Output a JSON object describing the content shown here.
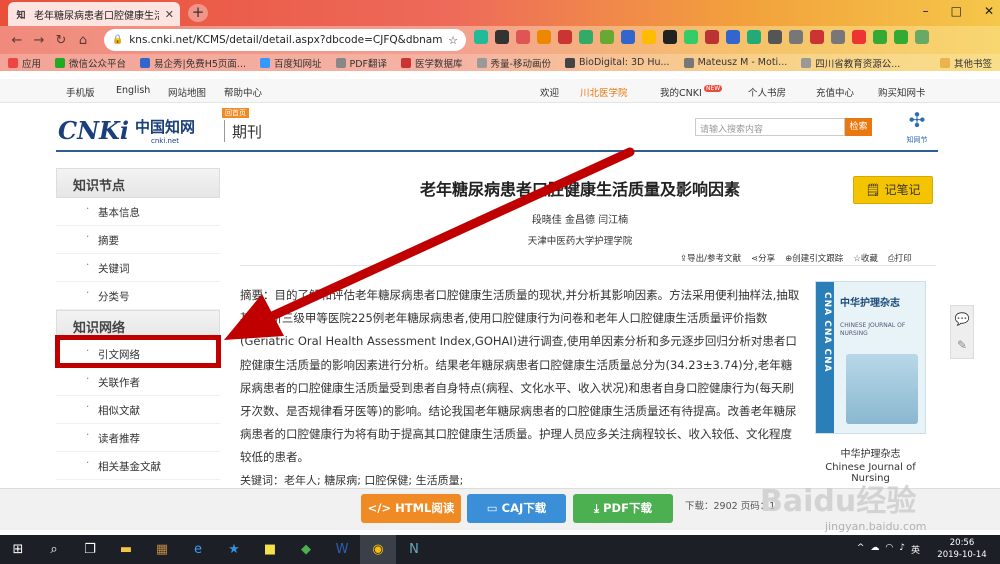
{
  "browser": {
    "tab_title": "老年糖尿病患者口腔健康生活质量",
    "tab_favicon": "知",
    "new_tab": "+",
    "url": "kns.cnki.net/KCMS/detail/detail.aspx?dbcode=CJFQ&dbnam...",
    "window_controls": [
      "–",
      "□",
      "✕"
    ],
    "bookmarks": [
      {
        "label": "应用",
        "color": "#e44"
      },
      {
        "label": "微信公众平台",
        "color": "#2a2"
      },
      {
        "label": "易企秀|免费H5页面...",
        "color": "#36c"
      },
      {
        "label": "百度知网址",
        "color": "#39f"
      },
      {
        "label": "PDF翻译",
        "color": "#888"
      },
      {
        "label": "医学数据库",
        "color": "#c33"
      },
      {
        "label": "秀量-移动画份",
        "color": "#999"
      },
      {
        "label": "BioDigital: 3D Hu...",
        "color": "#444"
      },
      {
        "label": "Mateusz M - Moti...",
        "color": "#777"
      },
      {
        "label": "四川省教育资源公...",
        "color": "#999"
      },
      {
        "label": "其他书签",
        "color": "#e9b44c"
      }
    ],
    "extension_colors": [
      "#2b9",
      "#333",
      "#d55",
      "#e80",
      "#c33",
      "#3a6",
      "#6a3",
      "#36c",
      "#fb0",
      "#222",
      "#3c6",
      "#b33",
      "#36c",
      "#2a7",
      "#555",
      "#777",
      "#c33",
      "#777",
      "#e33",
      "#3a3",
      "#3a3",
      "#6a6"
    ]
  },
  "cnki_nav": {
    "left": [
      "手机版",
      "English",
      "网站地图",
      "帮助中心"
    ],
    "right": [
      "欢迎",
      "川北医学院",
      "我的CNKI",
      "个人书房",
      "充值中心",
      "购买知网卡"
    ],
    "new_badge": "NEW"
  },
  "header": {
    "logo_en": "CNKi",
    "logo_cn": "中国知网",
    "logo_sub": "cnki.net",
    "home_badge": "回首页",
    "section": "期刊",
    "search_placeholder": "请输入搜索内容",
    "search_button": "检索",
    "brand": "知网节"
  },
  "sidebar": {
    "section1": "知识节点",
    "items1": [
      "基本信息",
      "摘要",
      "关键词",
      "分类号"
    ],
    "section2": "知识网络",
    "items2": [
      "引文网络",
      "关联作者",
      "相似文献",
      "读者推荐",
      "相关基金文献"
    ]
  },
  "article": {
    "title": "老年糖尿病患者口腔健康生活质量及影响因素",
    "authors": "段晓佳   金昌德   闫江楠",
    "affiliation": "天津中医药大学护理学院",
    "note_button": "记笔记",
    "tools": [
      "导出/参考文献",
      "分享",
      "创建引文跟踪",
      "收藏",
      "打印"
    ],
    "abstract": "摘要：目的了解和评估老年糖尿病患者口腔健康生活质量的现状,并分析其影响因素。方法采用便利抽样法,抽取某市2所三级甲等医院225例老年糖尿病患者,使用口腔健康行为问卷和老年人口腔健康生活质量评价指数(Geriatric Oral Health Assessment Index,GOHAI)进行调查,使用单因素分析和多元逐步回归分析对患者口腔健康生活质量的影响因素进行分析。结果老年糖尿病患者口腔健康生活质量总分为(34.23±3.74)分,老年糖尿病患者的口腔健康生活质量受到患者自身特点(病程、文化水平、收入状况)和患者自身口腔健康行为(每天刷牙次数、是否规律看牙医等)的影响。结论我国老年糖尿病患者的口腔健康生活质量还有待提高。改善老年糖尿病患者的口腔健康行为将有助于提高其口腔健康生活质量。护理人员应多关注病程较长、收入较低、文化程度较低的患者。",
    "keywords": "关键词：老年人; 糖尿病; 口腔保健; 生活质量;"
  },
  "journal": {
    "cover_vertical": "CNA CNA CNA",
    "cover_cn": "中华护理杂志",
    "cover_en": "CHINESE JOURNAL OF NURSING",
    "name_cn": "中华护理杂志",
    "name_en": "Chinese Journal of Nursing"
  },
  "download": {
    "html": "HTML阅读",
    "caj": "CAJ下载",
    "pdf": "PDF下载",
    "info": "下载：2902  页码：1"
  },
  "taskbar": {
    "time": "20:56",
    "date": "2019-10-14",
    "lang": "英",
    "tray": "^"
  },
  "watermark": {
    "brand": "Baidu经验",
    "url": "jingyan.baidu.com"
  }
}
